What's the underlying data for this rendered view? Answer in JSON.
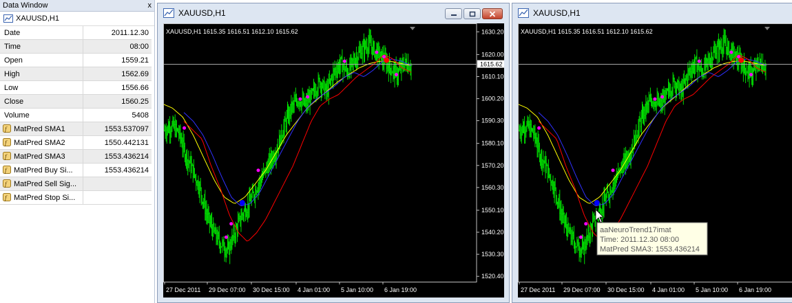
{
  "data_window": {
    "title": "Data Window",
    "close_glyph": "x",
    "symbol": "XAUUSD,H1",
    "rows": [
      {
        "name": "Date",
        "value": "2011.12.30"
      },
      {
        "name": "Time",
        "value": "08:00"
      },
      {
        "name": "Open",
        "value": "1559.21"
      },
      {
        "name": "High",
        "value": "1562.69"
      },
      {
        "name": "Low",
        "value": "1556.66"
      },
      {
        "name": "Close",
        "value": "1560.25"
      },
      {
        "name": "Volume",
        "value": "5408"
      }
    ],
    "indicators": [
      {
        "name": "MatPred SMA1",
        "value": "1553.537097"
      },
      {
        "name": "MatPred SMA2",
        "value": "1550.442131"
      },
      {
        "name": "MatPred SMA3",
        "value": "1553.436214"
      },
      {
        "name": "MatPred Buy Si...",
        "value": "1553.436214"
      },
      {
        "name": "MatPred Sell Sig...",
        "value": ""
      },
      {
        "name": "MatPred Stop Si...",
        "value": ""
      }
    ]
  },
  "chart_window_1": {
    "title": "XAUUSD,H1",
    "header": "XAUUSD,H1  1615.35 1616.51 1612.10 1615.62",
    "current_price": "1615.62",
    "price_labels": [
      "1630.20",
      "1620.00",
      "1610.10",
      "1600.20",
      "1590.30",
      "1580.10",
      "1570.20",
      "1560.30",
      "1550.10",
      "1540.20",
      "1530.30",
      "1520.40"
    ],
    "time_labels": [
      "27 Dec 2011",
      "29 Dec 07:00",
      "30 Dec 15:00",
      "4 Jan 01:00",
      "5 Jan 10:00",
      "6 Jan 19:00"
    ]
  },
  "chart_window_2": {
    "title": "XAUUSD,H1",
    "header": "XAUUSD,H1  1615.35 1616.51 1612.10 1615.62",
    "time_labels": [
      "27 Dec 2011",
      "29 Dec 07:00",
      "30 Dec 15:00",
      "4 Jan 01:00",
      "5 Jan 10:00",
      "6 Jan 19:00"
    ],
    "tooltip": {
      "line1": "aaNeuroTrend17imat",
      "line2": "Time: 2011.12.30 08:00",
      "line3": "MatPred SMA3: 1553.436214"
    }
  },
  "colors": {
    "bars": "#00dd00",
    "sma_red": "#ff0000",
    "sma_blue": "#3030ff",
    "sma_yellow": "#ffff00",
    "signal_magenta": "#ff00ff",
    "buy_signal": "#0000ff",
    "sell_signal": "#ff0000",
    "chart_bg": "#000000"
  },
  "chart_data": {
    "type": "candlestick-ohlc",
    "symbol": "XAUUSD",
    "timeframe": "H1",
    "last_bar": {
      "open": 1615.35,
      "high": 1616.51,
      "low": 1612.1,
      "close": 1615.62
    },
    "close_path": [
      1586,
      1588,
      1585,
      1575,
      1568,
      1560,
      1548,
      1540,
      1535,
      1532,
      1540,
      1548,
      1553,
      1560,
      1566,
      1572,
      1578,
      1588,
      1596,
      1600,
      1597,
      1602,
      1608,
      1603,
      1612,
      1616,
      1612,
      1618,
      1622,
      1625,
      1621,
      1618,
      1614,
      1611,
      1616,
      1615
    ],
    "sma_red": [
      1590,
      1586,
      1582,
      1570,
      1560,
      1548,
      1540,
      1536,
      1540,
      1546,
      1554,
      1562,
      1570,
      1580,
      1590,
      1597,
      1600,
      1602,
      1606,
      1610,
      1613,
      1616,
      1620,
      1618,
      1614,
      1612
    ],
    "sma_blue": [
      1594,
      1590,
      1584,
      1575,
      1565,
      1556,
      1552,
      1553,
      1558,
      1566,
      1574,
      1582,
      1590,
      1596,
      1600,
      1603,
      1606,
      1610,
      1612,
      1610,
      1613,
      1617,
      1618,
      1617,
      1615
    ],
    "sma_yellow": [
      1598,
      1596,
      1592,
      1584,
      1574,
      1564,
      1556,
      1553,
      1556,
      1562,
      1568,
      1576,
      1584,
      1590,
      1596,
      1600,
      1604,
      1608,
      1611,
      1614,
      1616,
      1617,
      1617,
      1616,
      1615
    ],
    "buy_signal": {
      "time": "2011.12.30 08:00",
      "price": 1553.436214
    },
    "sell_signal": {
      "time": "6 Jan",
      "price": 1617.5
    },
    "y_range": [
      1518,
      1634
    ]
  }
}
